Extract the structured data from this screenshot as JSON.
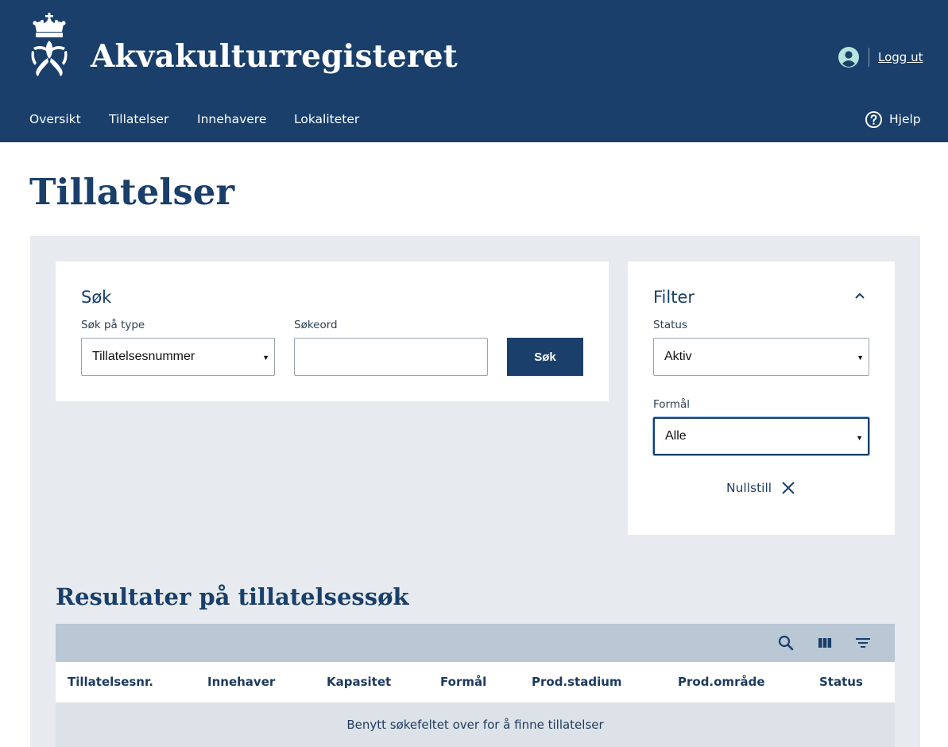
{
  "header": {
    "app_title": "Akvakulturregisteret",
    "logout_label": "Logg ut",
    "brand_color": "#193f6a"
  },
  "nav": {
    "items": [
      {
        "label": "Oversikt"
      },
      {
        "label": "Tillatelser"
      },
      {
        "label": "Innehavere"
      },
      {
        "label": "Lokaliteter"
      }
    ],
    "help_label": "Hjelp"
  },
  "page": {
    "title": "Tillatelser"
  },
  "search": {
    "title": "Søk",
    "type_label": "Søk på type",
    "type_value": "Tillatelsesnummer",
    "keyword_label": "Søkeord",
    "keyword_value": "",
    "button_label": "Søk"
  },
  "filter": {
    "title": "Filter",
    "status_label": "Status",
    "status_value": "Aktiv",
    "purpose_label": "Formål",
    "purpose_value": "Alle",
    "reset_label": "Nullstill"
  },
  "results": {
    "title": "Resultater på tillatelsessøk",
    "toolbar_icons": [
      "search-icon",
      "columns-icon",
      "filter-list-icon"
    ],
    "columns": [
      {
        "label": "Tillatelsesnr."
      },
      {
        "label": "Innehaver"
      },
      {
        "label": "Kapasitet"
      },
      {
        "label": "Formål"
      },
      {
        "label": "Prod.stadium"
      },
      {
        "label": "Prod.område"
      },
      {
        "label": "Status"
      }
    ],
    "empty_message": "Benytt søkefeltet over for å finne tillatelser"
  }
}
